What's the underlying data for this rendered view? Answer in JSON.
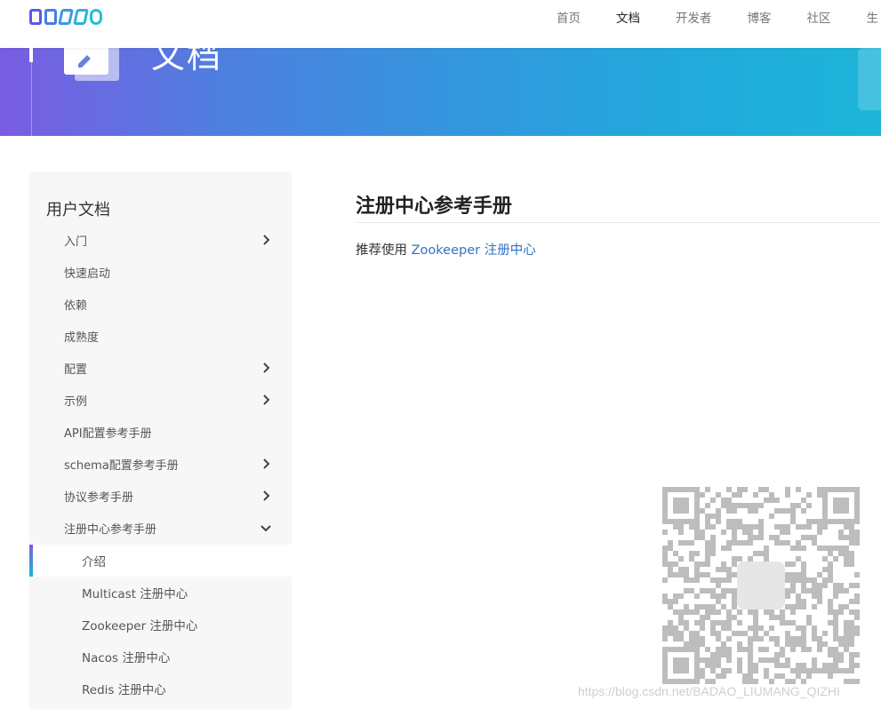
{
  "nav": {
    "links": [
      "首页",
      "文档",
      "开发者",
      "博客",
      "社区",
      "生"
    ],
    "active_index": 1
  },
  "banner": {
    "title": "文档"
  },
  "sidebar": {
    "title": "用户文档",
    "items": [
      {
        "label": "入门",
        "chevron": "right"
      },
      {
        "label": "快速启动",
        "chevron": ""
      },
      {
        "label": "依赖",
        "chevron": ""
      },
      {
        "label": "成熟度",
        "chevron": ""
      },
      {
        "label": "配置",
        "chevron": "right"
      },
      {
        "label": "示例",
        "chevron": "right"
      },
      {
        "label": "API配置参考手册",
        "chevron": ""
      },
      {
        "label": "schema配置参考手册",
        "chevron": "right"
      },
      {
        "label": "协议参考手册",
        "chevron": "right"
      },
      {
        "label": "注册中心参考手册",
        "chevron": "down"
      }
    ],
    "subitems": [
      {
        "label": "介绍",
        "active": true
      },
      {
        "label": "Multicast 注册中心",
        "active": false
      },
      {
        "label": "Zookeeper 注册中心",
        "active": false
      },
      {
        "label": "Nacos 注册中心",
        "active": false
      },
      {
        "label": "Redis 注册中心",
        "active": false
      }
    ]
  },
  "content": {
    "title": "注册中心参考手册",
    "para_prefix": "推荐使用 ",
    "para_link": "Zookeeper 注册中心"
  },
  "watermark": "https://blog.csdn.net/BADAO_LIUMANG_QIZHI",
  "colors": {
    "accent_link": "#2f74c0",
    "gradient_start": "#7a5ce2",
    "gradient_end": "#1db6d9"
  }
}
